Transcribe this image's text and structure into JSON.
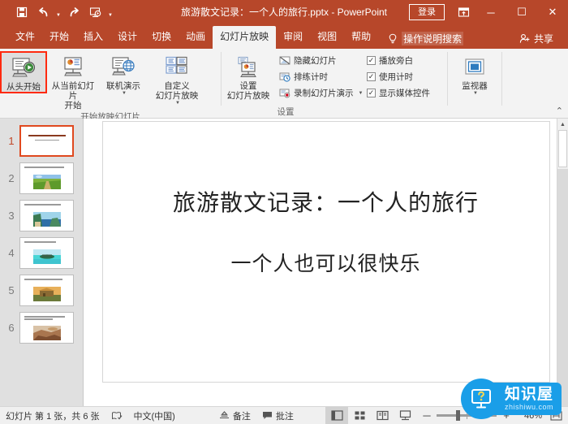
{
  "titlebar": {
    "document_title": "旅游散文记录：一个人的旅行.pptx  -  PowerPoint",
    "quick_access": [
      {
        "name": "save-icon",
        "label": "保存"
      },
      {
        "name": "undo-icon",
        "label": "撤消"
      },
      {
        "name": "redo-icon",
        "label": "恢复"
      },
      {
        "name": "start-from-beginning-icon",
        "label": "从头开始"
      },
      {
        "name": "customize-quick-access-icon",
        "label": "自定义快速访问工具栏"
      }
    ],
    "signin_label": "登录",
    "ribbon_display_options": "功能区显示选项",
    "minimize": "─",
    "maximize": "☐",
    "close": "✕"
  },
  "tabs": [
    {
      "label": "文件",
      "active": false
    },
    {
      "label": "开始",
      "active": false
    },
    {
      "label": "插入",
      "active": false
    },
    {
      "label": "设计",
      "active": false
    },
    {
      "label": "切换",
      "active": false
    },
    {
      "label": "动画",
      "active": false
    },
    {
      "label": "幻灯片放映",
      "active": true
    },
    {
      "label": "审阅",
      "active": false
    },
    {
      "label": "视图",
      "active": false
    },
    {
      "label": "帮助",
      "active": false
    }
  ],
  "tell_me": "操作说明搜索",
  "share_label": "共享",
  "ribbon": {
    "groups": [
      {
        "name": "start-slideshow-group",
        "label": "开始放映幻灯片",
        "buttons": [
          {
            "label": "从头开始",
            "icon": "play-from-start-icon",
            "selected": true,
            "dropdown": false
          },
          {
            "label": "从当前幻灯片\n开始",
            "icon": "play-from-current-icon",
            "selected": false,
            "dropdown": false
          },
          {
            "label": "联机演示",
            "icon": "present-online-icon",
            "selected": false,
            "dropdown": true
          },
          {
            "label": "自定义\n幻灯片放映",
            "icon": "custom-slideshow-icon",
            "selected": false,
            "dropdown": true
          }
        ]
      },
      {
        "name": "setup-group",
        "label": "设置",
        "big_button": {
          "label": "设置\n幻灯片放映",
          "icon": "setup-slideshow-icon"
        },
        "small_buttons": [
          {
            "label": "隐藏幻灯片",
            "icon": "hide-slide-icon",
            "checkbox": false
          },
          {
            "label": "排练计时",
            "icon": "rehearse-timings-icon",
            "checkbox": false
          },
          {
            "label": "录制幻灯片演示",
            "icon": "record-slideshow-icon",
            "checkbox": false,
            "dropdown": true
          }
        ],
        "checkboxes": [
          {
            "label": "播放旁白",
            "checked": true
          },
          {
            "label": "使用计时",
            "checked": true
          },
          {
            "label": "显示媒体控件",
            "checked": true
          }
        ]
      },
      {
        "name": "monitors-group",
        "label": "",
        "buttons": [
          {
            "label": "监视器",
            "icon": "monitor-icon",
            "selected": false,
            "dropdown": true
          }
        ]
      }
    ],
    "collapse_label": "折叠功能区"
  },
  "slides": [
    {
      "number": "1",
      "active": true,
      "title_lines": 2,
      "image": "none",
      "img_colors": []
    },
    {
      "number": "2",
      "active": false,
      "title_lines": 1,
      "image": "green-field",
      "img_colors": [
        "#8fc1e8",
        "#7fb23d",
        "#5e9a2c",
        "#c9b06a"
      ]
    },
    {
      "number": "3",
      "active": false,
      "title_lines": 1,
      "image": "coastal-cliff",
      "img_colors": [
        "#9fd4ea",
        "#3a7a52",
        "#2f6fa8",
        "#d8c79a"
      ]
    },
    {
      "number": "4",
      "active": false,
      "title_lines": 1,
      "image": "tropical-island",
      "img_colors": [
        "#bfe7f2",
        "#3fc4cf",
        "#2b6b4a",
        "#49d6d6"
      ]
    },
    {
      "number": "5",
      "active": false,
      "title_lines": 1,
      "image": "sunset-building",
      "img_colors": [
        "#e8b05a",
        "#8a6a33",
        "#6b7a3a",
        "#c98f3d"
      ]
    },
    {
      "number": "6",
      "active": false,
      "title_lines": 2,
      "image": "desert-canyon",
      "img_colors": [
        "#d9c2a6",
        "#a9764f",
        "#7d4e30",
        "#c59a6b"
      ]
    }
  ],
  "slide_view": {
    "title": "旅游散文记录：一个人的旅行",
    "subtitle": "一个人也可以很快乐"
  },
  "statusbar": {
    "slide_counter": "幻灯片 第 1 张，共 6 张",
    "spellcheck_icon": "spellcheck-icon",
    "language": "中文(中国)",
    "notes_label": "备注",
    "comments_label": "批注",
    "views": [
      {
        "name": "normal-view",
        "label": "普通视图",
        "active": true
      },
      {
        "name": "slide-sorter-view",
        "label": "幻灯片浏览",
        "active": false
      },
      {
        "name": "reading-view",
        "label": "阅读视图",
        "active": false
      },
      {
        "name": "slideshow-view",
        "label": "幻灯片放映",
        "active": false
      }
    ],
    "zoom_out": "─",
    "zoom_in": "+",
    "zoom_percent": "46%",
    "fit_label": "使幻灯片适应当前窗口"
  },
  "watermark": {
    "cn": "知识屋",
    "en": "zhishiwu.com",
    "icon": "monitor-question-icon",
    "color": "#1a9ee8"
  }
}
